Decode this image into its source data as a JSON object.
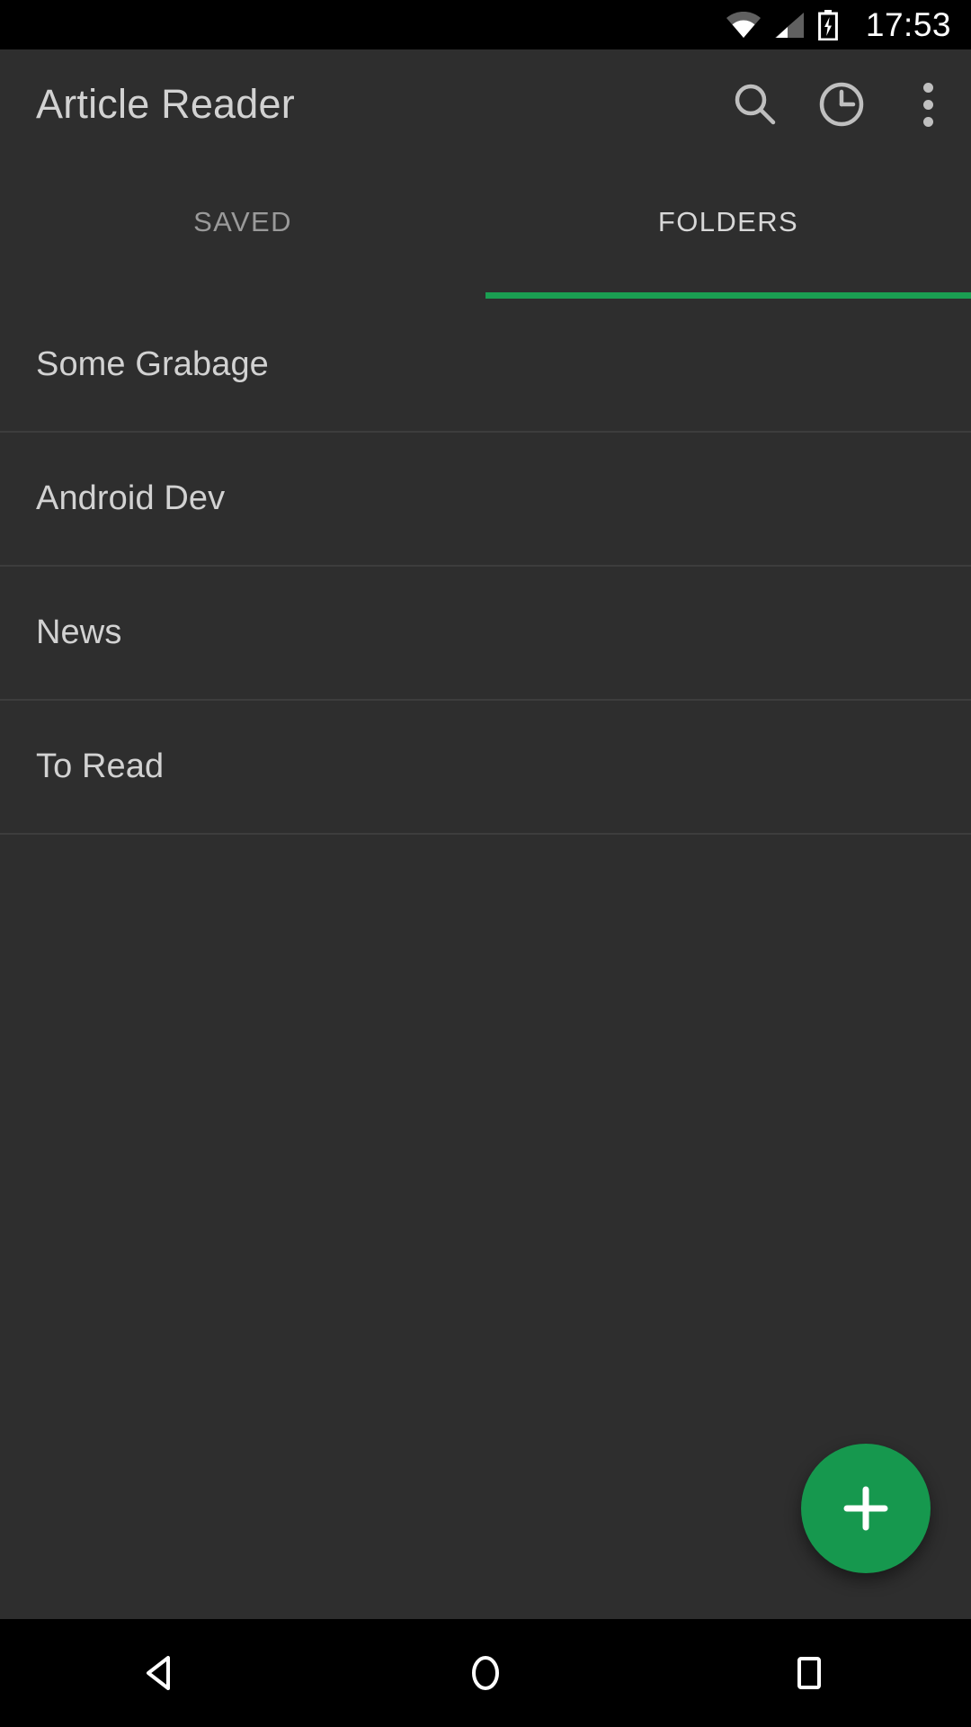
{
  "status_bar": {
    "time": "17:53",
    "icons": [
      "wifi-icon",
      "cellular-signal-icon",
      "battery-charging-icon"
    ]
  },
  "app_bar": {
    "title": "Article Reader",
    "actions": [
      {
        "name": "search-icon",
        "label": "Search"
      },
      {
        "name": "history-clock-icon",
        "label": "History"
      },
      {
        "name": "overflow-menu-icon",
        "label": "More options"
      }
    ]
  },
  "tabs": {
    "items": [
      {
        "label": "SAVED",
        "active": false
      },
      {
        "label": "FOLDERS",
        "active": true
      }
    ],
    "indicator_color": "#1a9e52",
    "active_index": 1
  },
  "folders": {
    "items": [
      {
        "name": "Some Grabage"
      },
      {
        "name": "Android Dev"
      },
      {
        "name": "News"
      },
      {
        "name": "To Read"
      }
    ]
  },
  "fab": {
    "label": "+",
    "action": "add-folder",
    "color": "#16984e"
  },
  "nav_bar": {
    "buttons": [
      {
        "name": "back-icon",
        "label": "Back"
      },
      {
        "name": "home-icon",
        "label": "Home"
      },
      {
        "name": "recents-icon",
        "label": "Recents"
      }
    ]
  },
  "colors": {
    "background": "#2e2e2e",
    "system_bars": "#000000",
    "accent": "#1a9e52",
    "primary_text": "#d2d2d2",
    "secondary_text": "#9a9a9a",
    "divider": "#3d3d3d"
  }
}
